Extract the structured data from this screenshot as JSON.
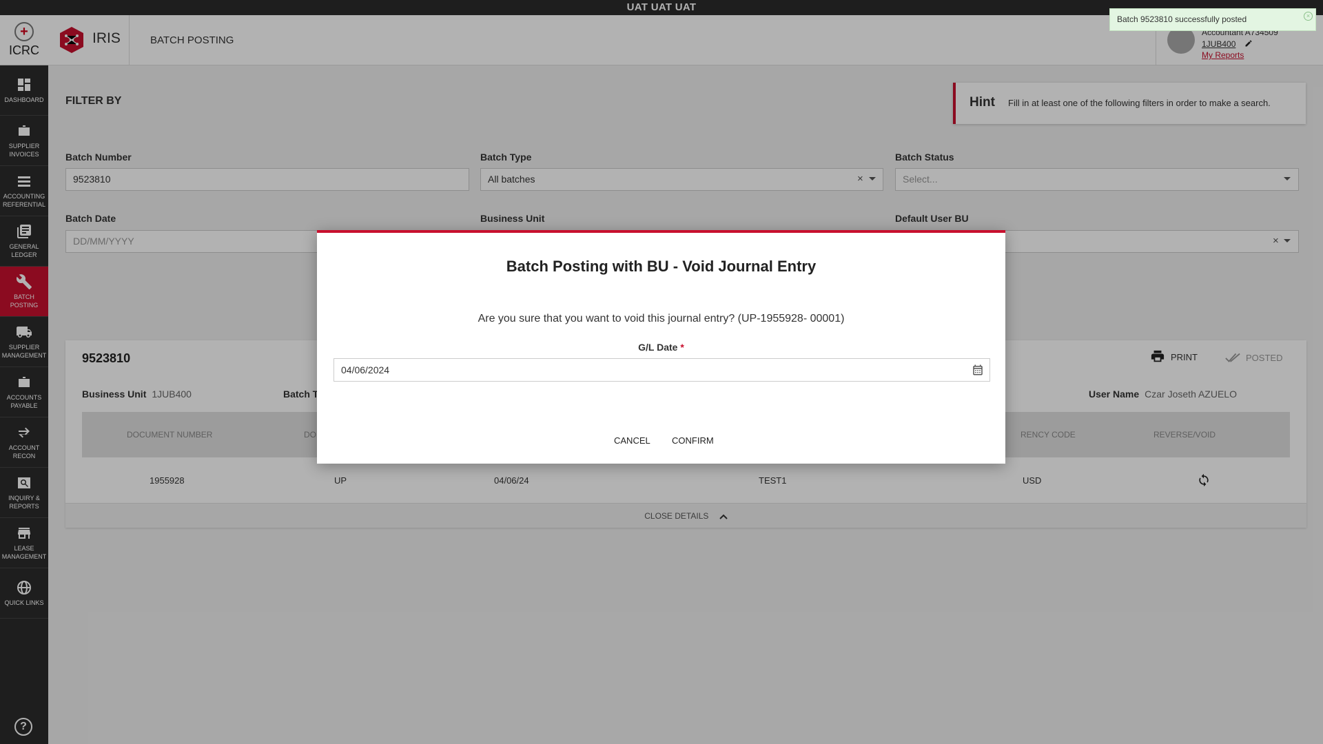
{
  "env_banner": "UAT UAT UAT",
  "toast": {
    "message": "Batch 9523810 successfully posted"
  },
  "brand": {
    "org": "ICRC",
    "app": "IRIS"
  },
  "page": {
    "title": "BATCH POSTING"
  },
  "user": {
    "role": "Accountant A734509",
    "bu": "1JUB400",
    "reports_link": "My Reports"
  },
  "sidebar": {
    "items": [
      {
        "label": "DASHBOARD",
        "icon": "dashboard-icon"
      },
      {
        "label": "SUPPLIER INVOICES",
        "icon": "briefcase-icon"
      },
      {
        "label": "ACCOUNTING REFERENTIAL",
        "icon": "list-icon"
      },
      {
        "label": "GENERAL LEDGER",
        "icon": "ledger-icon"
      },
      {
        "label": "BATCH POSTING",
        "icon": "wrench-icon"
      },
      {
        "label": "SUPPLIER MANAGEMENT",
        "icon": "truck-icon"
      },
      {
        "label": "ACCOUNTS PAYABLE",
        "icon": "briefcase-icon"
      },
      {
        "label": "ACCOUNT RECON",
        "icon": "arrows-icon"
      },
      {
        "label": "INQUIRY & REPORTS",
        "icon": "search-report-icon"
      },
      {
        "label": "LEASE MANAGEMENT",
        "icon": "store-icon"
      },
      {
        "label": "QUICK LINKS",
        "icon": "globe-icon"
      }
    ],
    "help": "?"
  },
  "filter": {
    "title": "FILTER BY",
    "hint_title": "Hint",
    "hint_text": "Fill in at least one of the following filters in order to make a search.",
    "batch_number": {
      "label": "Batch Number",
      "value": "9523810"
    },
    "batch_type": {
      "label": "Batch Type",
      "value": "All batches"
    },
    "batch_status": {
      "label": "Batch Status",
      "placeholder": "Select..."
    },
    "batch_date": {
      "label": "Batch Date",
      "placeholder": "DD/MM/YYYY"
    },
    "business_unit": {
      "label": "Business Unit"
    },
    "default_user_bu": {
      "label": "Default User BU"
    }
  },
  "result": {
    "batch_number": "9523810",
    "print_label": "PRINT",
    "status_label": "POSTED",
    "business_unit_label": "Business Unit",
    "business_unit_value": "1JUB400",
    "batch_type_label": "Batch Ty",
    "user_name_label": "User Name",
    "user_name_value": "Czar Joseth AZUELO",
    "columns": [
      "DOCUMENT NUMBER",
      "DO",
      "RENCY CODE",
      "REVERSE/VOID"
    ],
    "row": {
      "document_number": "1955928",
      "doc_type": "UP",
      "date": "04/06/24",
      "ref": "TEST1",
      "currency": "USD"
    },
    "close_details": "CLOSE DETAILS"
  },
  "modal": {
    "title": "Batch Posting with BU - Void Journal Entry",
    "question": "Are you sure that you want to void this journal entry? (UP-1955928- 00001)",
    "gl_date_label": "G/L Date",
    "required_mark": "*",
    "gl_date_value": "04/06/2024",
    "cancel_label": "CANCEL",
    "confirm_label": "CONFIRM"
  },
  "colors": {
    "accent": "#c8102e",
    "sidebar": "#2b2b2b",
    "toast_bg": "#e3f5e2"
  }
}
